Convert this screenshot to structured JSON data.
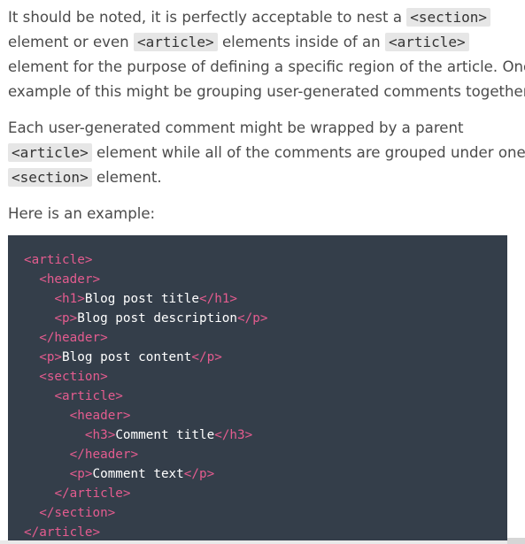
{
  "paragraph1": {
    "line1_text1": "It should be noted, it is perfectly acceptable to nest a ",
    "line1_code": "<section>",
    "line2_code1_prefix": "element or even ",
    "line2_code1": "<article>",
    "line2_mid": " elements inside of an ",
    "line2_code2": "<article>",
    "line3": "element for the purpose of defining a specific region of the article. One",
    "line4": "example of this might be grouping user-generated comments together."
  },
  "paragraph2": {
    "line1": "Each user-generated comment might be wrapped by a parent",
    "line2_code": "<article>",
    "line2_rest": " element while all of the comments are grouped under one",
    "line3_code": "<section>",
    "line3_rest": " element."
  },
  "paragraph3": {
    "text": "Here is an example:"
  },
  "code_block": {
    "lines": [
      {
        "indent": "",
        "parts": [
          {
            "t": "tag",
            "v": "<article>"
          }
        ]
      },
      {
        "indent": "  ",
        "parts": [
          {
            "t": "tag",
            "v": "<header>"
          }
        ]
      },
      {
        "indent": "    ",
        "parts": [
          {
            "t": "tag",
            "v": "<h1>"
          },
          {
            "t": "txt",
            "v": "Blog post title"
          },
          {
            "t": "tag",
            "v": "</h1>"
          }
        ]
      },
      {
        "indent": "    ",
        "parts": [
          {
            "t": "tag",
            "v": "<p>"
          },
          {
            "t": "txt",
            "v": "Blog post description"
          },
          {
            "t": "tag",
            "v": "</p>"
          }
        ]
      },
      {
        "indent": "  ",
        "parts": [
          {
            "t": "tag",
            "v": "</header>"
          }
        ]
      },
      {
        "indent": "  ",
        "parts": [
          {
            "t": "tag",
            "v": "<p>"
          },
          {
            "t": "txt",
            "v": "Blog post content"
          },
          {
            "t": "tag",
            "v": "</p>"
          }
        ]
      },
      {
        "indent": "  ",
        "parts": [
          {
            "t": "tag",
            "v": "<section>"
          }
        ]
      },
      {
        "indent": "    ",
        "parts": [
          {
            "t": "tag",
            "v": "<article>"
          }
        ]
      },
      {
        "indent": "      ",
        "parts": [
          {
            "t": "tag",
            "v": "<header>"
          }
        ]
      },
      {
        "indent": "        ",
        "parts": [
          {
            "t": "tag",
            "v": "<h3>"
          },
          {
            "t": "txt",
            "v": "Comment title"
          },
          {
            "t": "tag",
            "v": "</h3>"
          }
        ]
      },
      {
        "indent": "      ",
        "parts": [
          {
            "t": "tag",
            "v": "</header>"
          }
        ]
      },
      {
        "indent": "      ",
        "parts": [
          {
            "t": "tag",
            "v": "<p>"
          },
          {
            "t": "txt",
            "v": "Comment text"
          },
          {
            "t": "tag",
            "v": "</p>"
          }
        ]
      },
      {
        "indent": "    ",
        "parts": [
          {
            "t": "tag",
            "v": "</article>"
          }
        ]
      },
      {
        "indent": "  ",
        "parts": [
          {
            "t": "tag",
            "v": "</section>"
          }
        ]
      },
      {
        "indent": "",
        "parts": [
          {
            "t": "tag",
            "v": "</article>"
          }
        ]
      }
    ]
  },
  "colors": {
    "code_background": "#343e4a",
    "tag_color": "#e45c8f",
    "code_text_color": "#ffffff",
    "body_text_color": "#4b4b4b",
    "inline_code_background": "#e6e6e6"
  }
}
